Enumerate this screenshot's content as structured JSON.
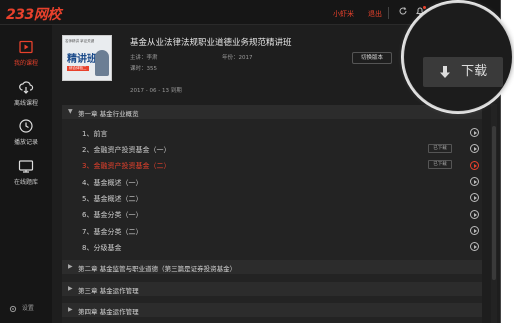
{
  "app": {
    "logo": "233网校"
  },
  "titlebar": {
    "user": "小虾米",
    "logout": "退出"
  },
  "sidebar": {
    "items": [
      {
        "label": "我的课程",
        "icon": "course-icon",
        "active": true
      },
      {
        "label": "离线课程",
        "icon": "cloud-download-icon",
        "active": false
      },
      {
        "label": "播放记录",
        "icon": "history-icon",
        "active": false
      },
      {
        "label": "在线题库",
        "icon": "question-bank-icon",
        "active": false
      }
    ],
    "settings": "设置"
  },
  "course": {
    "cover": {
      "tag": "名师精讲  拿证关键",
      "title": "精讲班",
      "sub": "综合体验二"
    },
    "title": "基金从业法律法规职业道德业务规范精讲班",
    "teacher": "主讲：李肃",
    "year": "年份：2017",
    "hours": "课时：355",
    "expire": "2017 - 06 - 13 到期",
    "switch_label": "切换版本",
    "download_label": "下载"
  },
  "chapters": [
    {
      "title": "第一章  基金行业概览",
      "expanded": true,
      "lessons": [
        {
          "title": "1、前言",
          "status": ""
        },
        {
          "title": "2、金融资产投资基金（一）",
          "status": "已下载"
        },
        {
          "title": "3、金融资产投资基金（二）",
          "status": "已下载",
          "active": true
        },
        {
          "title": "4、基金概述（一）",
          "status": ""
        },
        {
          "title": "5、基金概述（二）",
          "status": ""
        },
        {
          "title": "6、基金分类（一）",
          "status": ""
        },
        {
          "title": "7、基金分类（二）",
          "status": ""
        },
        {
          "title": "8、分级基金",
          "status": ""
        }
      ]
    },
    {
      "title": "第二章  基金监管与职业道德（第三篇是证券投资基金）",
      "expanded": false
    },
    {
      "title": "第三章  基金运作管理",
      "expanded": false
    },
    {
      "title": "第四章  基金运作管理",
      "expanded": false
    }
  ],
  "colors": {
    "accent": "#e8412c",
    "bg": "#1e1e1e",
    "panel": "#232323"
  }
}
